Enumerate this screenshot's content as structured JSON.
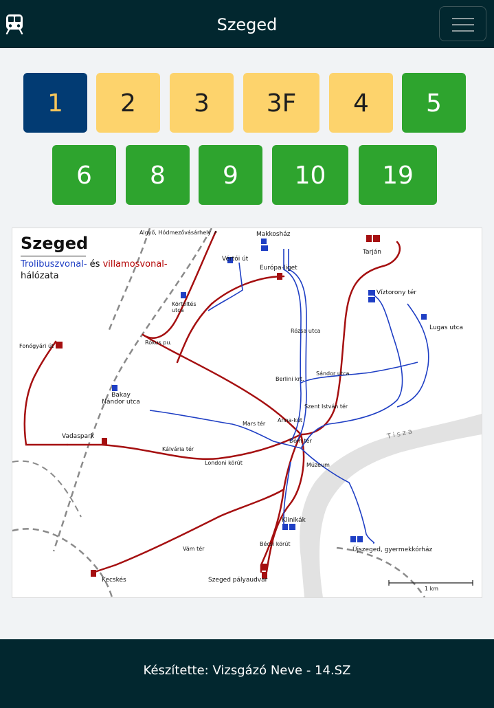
{
  "header": {
    "title": "Szeged",
    "icon": "tram-icon",
    "menu_icon": "hamburger-menu-icon"
  },
  "lines": [
    {
      "label": "1",
      "color": "#023b73",
      "text_color": "#f6c65b",
      "selected": true
    },
    {
      "label": "2",
      "color": "#fdd36c",
      "text_color": "#1e1e1e"
    },
    {
      "label": "3",
      "color": "#fdd36c",
      "text_color": "#1e1e1e"
    },
    {
      "label": "3F",
      "color": "#fdd36c",
      "text_color": "#1e1e1e"
    },
    {
      "label": "4",
      "color": "#fdd36c",
      "text_color": "#1e1e1e"
    },
    {
      "label": "5",
      "color": "#2ea42e",
      "text_color": "#ffffff"
    },
    {
      "label": "6",
      "color": "#2ea42e",
      "text_color": "#ffffff"
    },
    {
      "label": "8",
      "color": "#2ea42e",
      "text_color": "#ffffff"
    },
    {
      "label": "9",
      "color": "#2ea42e",
      "text_color": "#ffffff"
    },
    {
      "label": "10",
      "color": "#2ea42e",
      "text_color": "#ffffff"
    },
    {
      "label": "19",
      "color": "#2ea42e",
      "text_color": "#ffffff"
    }
  ],
  "map": {
    "title": "Szeged",
    "subtitle_trolley": "Trolibuszvonal-",
    "subtitle_and": " és ",
    "subtitle_tram": "villamosvonal-",
    "subtitle_line2": "hálózata",
    "tram_color": "#a50f10",
    "trolley_color": "#1f3fc4",
    "scale_label": "1 km",
    "labels": {
      "algyo": "Algyő, Hódmezővásárhely ↗",
      "makkoshaz": "Makkosház",
      "tarjan": "Tarján",
      "vertoi": "Vértói út",
      "europa": "Európa-liget",
      "kortoltes": "Körtöltés utca",
      "viztorony": "Víztorony tér",
      "lugas": "Lugas utca",
      "fonogyari": "Fonógyári út",
      "bakay": "Bakay Nándor utca",
      "vadaspark": "Vadaspark",
      "klinikak": "Klinikák",
      "ujszeged": "Újszeged, gyermekkórház",
      "kecskes": "Kecskés",
      "palyaudvar": "Szeged pályaudvar",
      "tisza": "Tisza",
      "rokus": "Rókus pu.",
      "mars": "Mars tér",
      "anna": "Anna-kút",
      "dom": "Dóm tér",
      "muzeum": "Múzeum",
      "tolbuhin": "Szent István tér",
      "rozsa": "Rózsa utca",
      "sandor": "Sándor utca",
      "berlini": "Berlini krt.",
      "kalvaria": "Kálvária tér",
      "londoni": "Londoni körút",
      "vam": "Vám tér",
      "bosi": "Bécsi körút"
    }
  },
  "footer": {
    "text": "Készítette: Vizsgázó Neve - 14.SZ"
  }
}
